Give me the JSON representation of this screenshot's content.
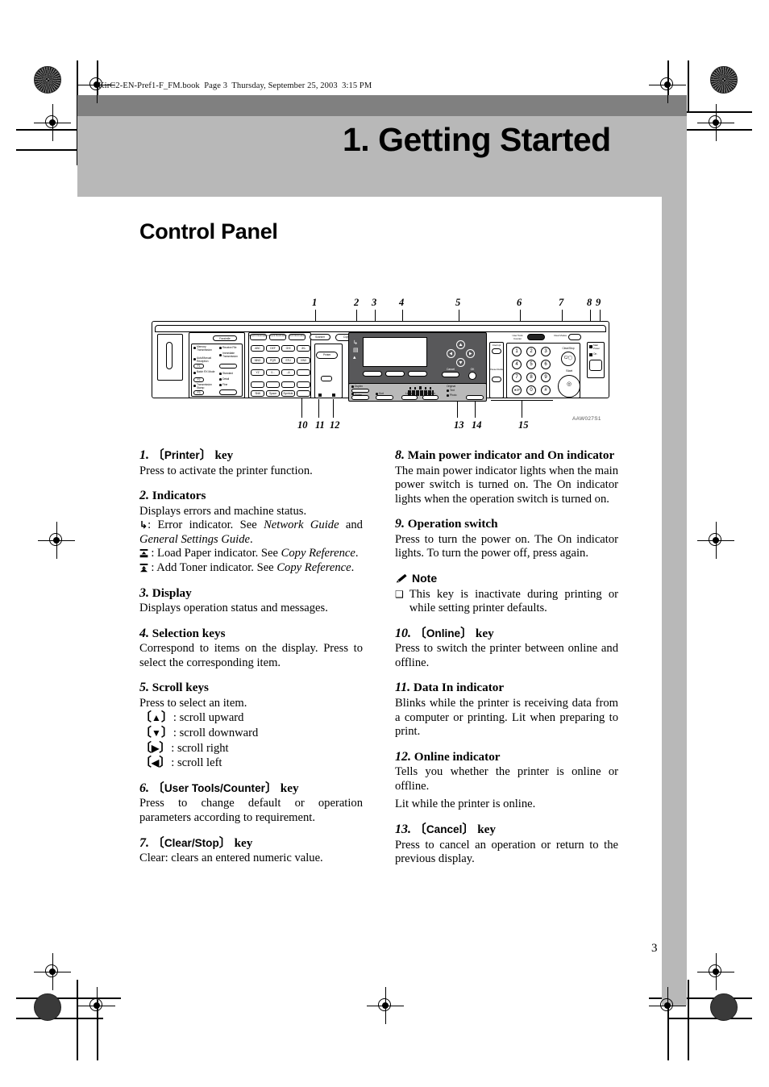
{
  "page": {
    "slug": "KirC2-EN-Pref1-F_FM.book  Page 3  Thursday, September 25, 2003  3:15 PM",
    "chapter_title": "1. Getting Started",
    "section_title": "Control Panel",
    "page_number": "3",
    "figure_id": "AAW027S1"
  },
  "figure": {
    "callout_numbers_top": [
      "1",
      "2",
      "3",
      "4",
      "5",
      "6",
      "7",
      "8",
      "9"
    ],
    "callout_numbers_bottom": [
      "10",
      "11",
      "12",
      "13",
      "14",
      "15"
    ],
    "panel_labels": {
      "facsimile": "Facsimile",
      "scanner": "Scanner",
      "copy": "Copy",
      "printer": "Printer",
      "search_destination": "Search Destination",
      "check_destination": "Check Destination",
      "job_information": "Job Information",
      "user_tools_counter": "User Tools Counter",
      "clear_modes": "Clear Modes",
      "clear_stop": "Clear/Stop",
      "start": "Start",
      "cancel": "Cancel",
      "ok": "OK",
      "interrupt": "Interrupt",
      "pause_redial": "Pause Redial",
      "duplex": "Duplex",
      "combine_series": "Combine Series",
      "sort": "Sort",
      "lighter": "Lighter",
      "darker": "Darker",
      "original": "Original",
      "text": "Text",
      "photo": "Photo",
      "main_power": "Main Power",
      "on": "On",
      "memory_transmission": "Memory Transmission",
      "immediate_transmission": "Immediate Transmission",
      "auto_manual_reception": "Auto/Manual Reception",
      "batch_rx_mode": "Batch RX Mode",
      "transmission_stamp": "Transmission Stamp",
      "receive_file": "Receive File",
      "standard": "Standard",
      "detail": "Detail",
      "fine": "Fine",
      "f1": "F1",
      "f2": "F2",
      "f3": "F3",
      "keys_row1": [
        "ABC",
        "DEF",
        "GHI",
        "JKL"
      ],
      "keys_row2": [
        "MNO",
        "PQR",
        "STU",
        "VWX"
      ],
      "keys_row3": [
        "YZ",
        "0...",
        "-.&",
        ""
      ],
      "keys_row4": [
        "Shift",
        "Space",
        "Symbols",
        ""
      ],
      "tenkey": [
        "1",
        "2",
        "3",
        "4",
        "5",
        "6",
        "7",
        "8",
        "9",
        "∗/#",
        "0",
        "#"
      ]
    }
  },
  "left_column": [
    {
      "num": "1.",
      "keycap": "Printer",
      "suffix": " key",
      "paragraphs": [
        "Press to activate the printer function."
      ]
    },
    {
      "num": "2.",
      "title": "Indicators",
      "paragraphs": [
        "Displays errors and machine status."
      ],
      "indicators": [
        {
          "glyph": "error",
          "text_before": ": Error indicator. See ",
          "italic1": "Network Guide",
          "mid": " and ",
          "italic2": "General Settings Guide",
          "tail": "."
        },
        {
          "glyph": "load-paper",
          "text_before": ": Load Paper indicator. See ",
          "italic1": "Copy Reference",
          "tail": "."
        },
        {
          "glyph": "add-toner",
          "text_before": ": Add Toner indicator. See ",
          "italic1": "Copy Reference",
          "tail": "."
        }
      ]
    },
    {
      "num": "3.",
      "title": "Display",
      "paragraphs": [
        "Displays operation status and messages."
      ]
    },
    {
      "num": "4.",
      "title": "Selection keys",
      "paragraphs": [
        "Correspond to items on the display. Press to select the corresponding item."
      ]
    },
    {
      "num": "5.",
      "title": "Scroll keys",
      "paragraphs": [
        "Press to select an item."
      ],
      "scroll": [
        {
          "arrow": "▲",
          "text": ": scroll upward"
        },
        {
          "arrow": "▼",
          "text": ": scroll downward"
        },
        {
          "arrow": "▶",
          "text": ": scroll right"
        },
        {
          "arrow": "◀",
          "text": ": scroll left"
        }
      ]
    },
    {
      "num": "6.",
      "keycap": "User Tools/Counter",
      "suffix": " key",
      "paragraphs": [
        "Press to change default or operation parameters according to requirement."
      ]
    },
    {
      "num": "7.",
      "keycap": "Clear/Stop",
      "suffix": " key",
      "paragraphs": [
        "Clear: clears an entered numeric value."
      ]
    }
  ],
  "right_column": [
    {
      "num": "8.",
      "title": "Main power indicator and On indicator",
      "paragraphs": [
        "The main power indicator lights when the main power switch is turned on. The On indicator lights when the operation switch is turned on."
      ]
    },
    {
      "num": "9.",
      "title": "Operation switch",
      "paragraphs": [
        "Press to turn the power on. The On indicator lights. To turn the power off, press again."
      ]
    },
    {
      "note": {
        "label": "Note",
        "bullet": "❑",
        "text": "This key is inactivate during printing or while setting printer defaults."
      }
    },
    {
      "num": "10.",
      "keycap": "Online",
      "suffix": " key",
      "paragraphs": [
        "Press to switch the printer between online and offline."
      ]
    },
    {
      "num": "11.",
      "title": "Data In indicator",
      "paragraphs": [
        "Blinks while the printer is receiving data from a computer or printing. Lit when preparing to print."
      ]
    },
    {
      "num": "12.",
      "title": "Online indicator",
      "paragraphs": [
        "Tells you whether the printer is online or offline.",
        "Lit while the printer is online."
      ]
    },
    {
      "num": "13.",
      "keycap": "Cancel",
      "suffix": " key",
      "paragraphs": [
        "Press to cancel an operation or return to the previous display."
      ]
    }
  ]
}
